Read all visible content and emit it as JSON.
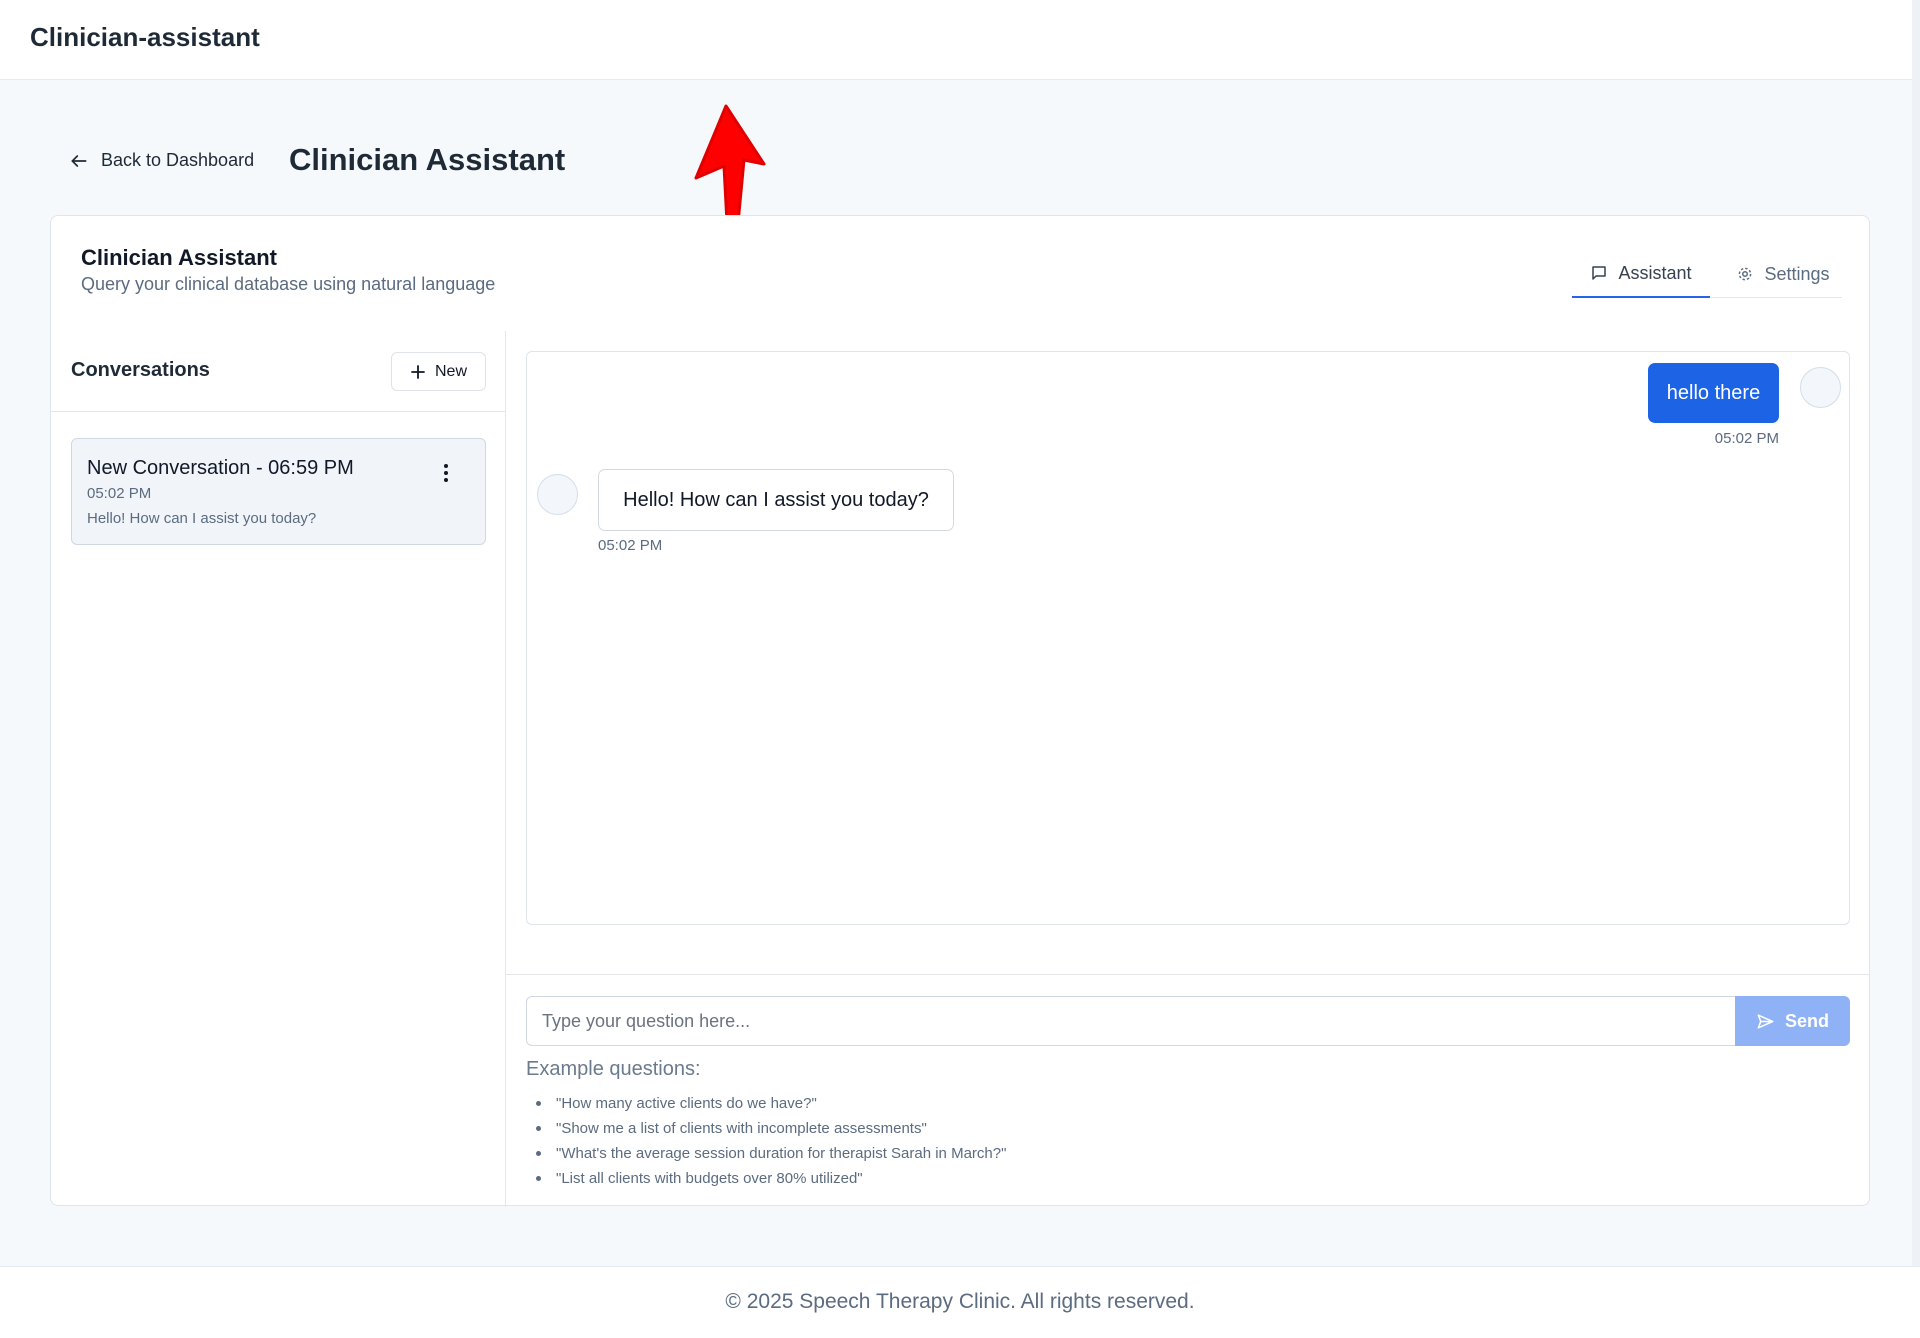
{
  "app": {
    "title": "Clinician-assistant"
  },
  "page": {
    "back_label": "Back to Dashboard",
    "title": "Clinician Assistant"
  },
  "card": {
    "title": "Clinician Assistant",
    "subtitle": "Query your clinical database using natural language"
  },
  "tabs": [
    {
      "label": "Assistant",
      "icon": "message-square-icon",
      "active": true
    },
    {
      "label": "Settings",
      "icon": "gear-icon",
      "active": false
    }
  ],
  "sidebar": {
    "heading": "Conversations",
    "new_label": "New",
    "conversations": [
      {
        "title": "New Conversation - 06:59 PM",
        "time": "05:02 PM",
        "preview": "Hello! How can I assist you today?"
      }
    ]
  },
  "messages": [
    {
      "role": "user",
      "text": "hello there",
      "time": "05:02 PM"
    },
    {
      "role": "assistant",
      "text": "Hello! How can I assist you today?",
      "time": "05:02 PM"
    }
  ],
  "composer": {
    "placeholder": "Type your question here...",
    "value": "",
    "send_label": "Send",
    "examples_label": "Example questions:",
    "examples": [
      "\"How many active clients do we have?\"",
      "\"Show me a list of clients with incomplete assessments\"",
      "\"What's the average session duration for therapist Sarah in March?\"",
      "\"List all clients with budgets over 80% utilized\""
    ]
  },
  "footer": {
    "text": "© 2025 Speech Therapy Clinic. All rights reserved."
  },
  "colors": {
    "primary": "#1d63e6",
    "send_disabled": "#8fb2f6",
    "annotation_arrow": "#ff0000"
  }
}
